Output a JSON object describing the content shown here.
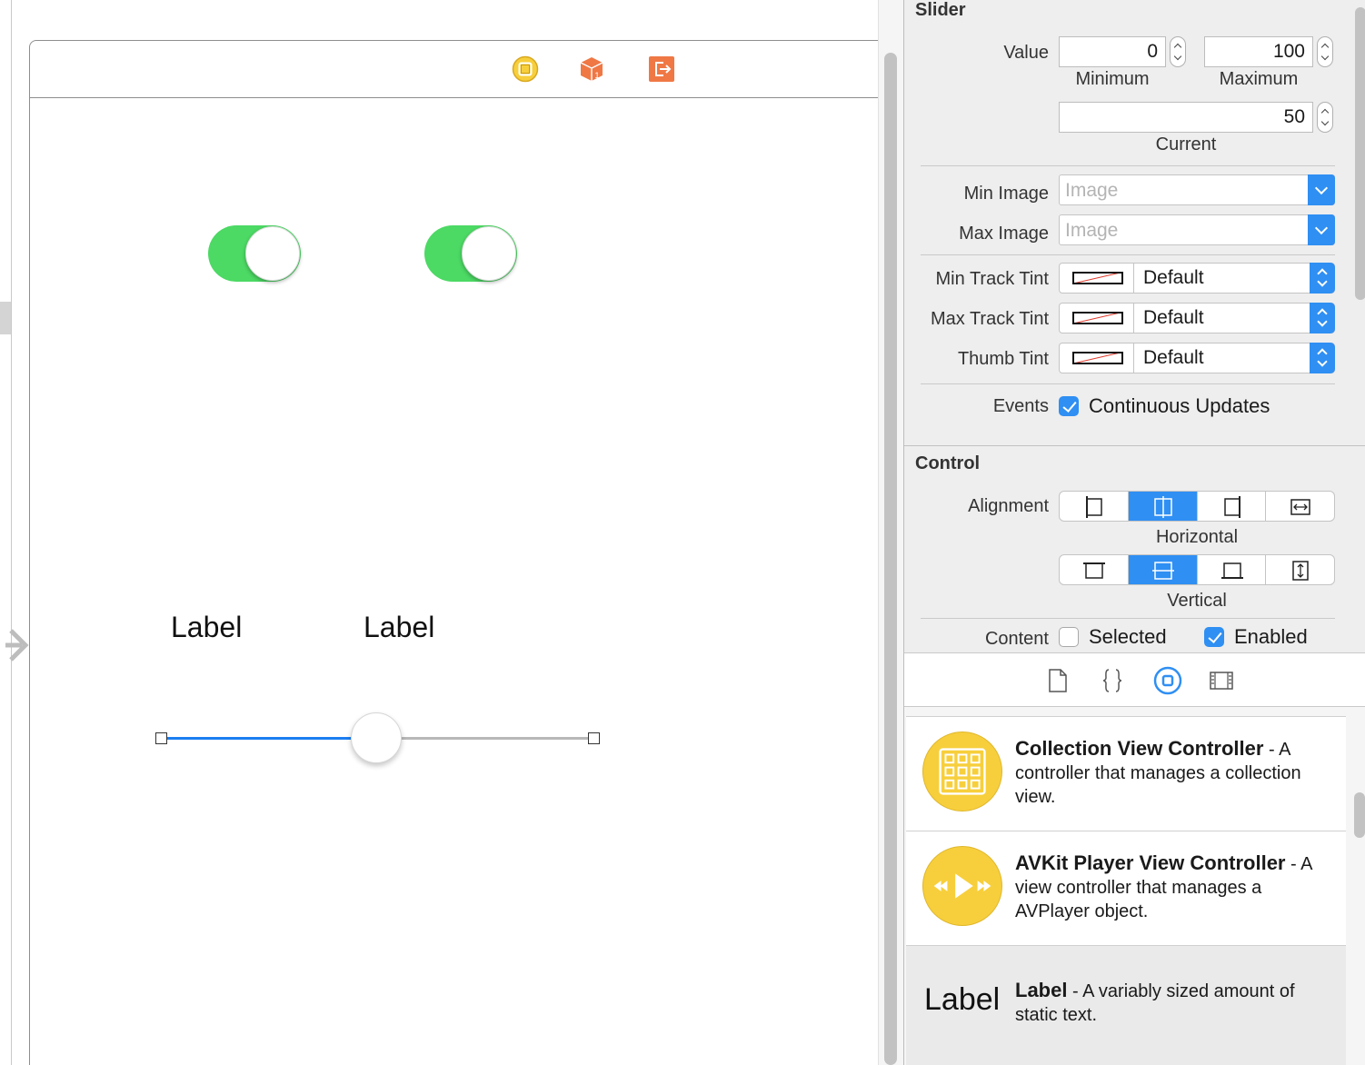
{
  "canvas": {
    "switches": [
      {
        "state": "on"
      },
      {
        "state": "on"
      }
    ],
    "labels": [
      "Label",
      "Label"
    ],
    "slider": {
      "value": 50,
      "min": 0,
      "max": 100
    },
    "dock_icons": [
      "view-controller-icon",
      "first-responder-icon",
      "exit-icon"
    ]
  },
  "inspector": {
    "slider_section": {
      "title": "Slider",
      "value_label": "Value",
      "minimum": "0",
      "minimum_label": "Minimum",
      "maximum": "100",
      "maximum_label": "Maximum",
      "current": "50",
      "current_label": "Current",
      "min_image_label": "Min Image",
      "min_image_placeholder": "Image",
      "max_image_label": "Max Image",
      "max_image_placeholder": "Image",
      "min_track_tint_label": "Min Track Tint",
      "min_track_tint_value": "Default",
      "max_track_tint_label": "Max Track Tint",
      "max_track_tint_value": "Default",
      "thumb_tint_label": "Thumb Tint",
      "thumb_tint_value": "Default",
      "events_label": "Events",
      "continuous_updates_label": "Continuous Updates",
      "continuous_updates_checked": true
    },
    "control_section": {
      "title": "Control",
      "alignment_label": "Alignment",
      "horizontal_label": "Horizontal",
      "vertical_label": "Vertical",
      "horizontal_selected_index": 1,
      "vertical_selected_index": 1,
      "content_label": "Content",
      "selected_label": "Selected",
      "selected_checked": false,
      "enabled_label": "Enabled",
      "enabled_checked": true
    }
  },
  "library": {
    "tabs": [
      "file-template-icon",
      "code-snippet-icon",
      "object-library-icon",
      "media-library-icon"
    ],
    "active_tab": 2,
    "items": [
      {
        "title": "Collection View Controller",
        "desc": " - A controller that manages a collection view.",
        "icon": "collection-view-controller-icon"
      },
      {
        "title": "AVKit Player View Controller",
        "desc": " - A view controller that manages a AVPlayer object.",
        "icon": "avkit-player-icon"
      },
      {
        "title": "Label",
        "desc": " - A variably sized amount of static text.",
        "preview": "Label"
      }
    ]
  },
  "colors": {
    "accent": "#2f8ff3",
    "switch_on": "#4cd964",
    "slider_min_track": "#1c7ef1",
    "dock_vc": "#f7cf3c",
    "dock_orange": "#ef7845"
  }
}
